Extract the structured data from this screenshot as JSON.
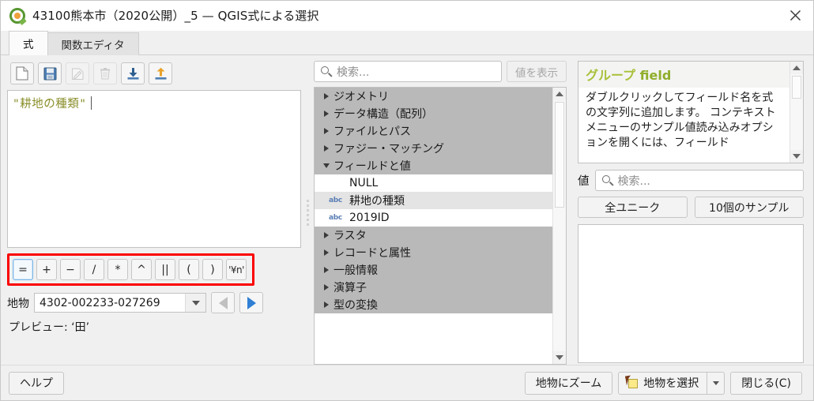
{
  "window": {
    "title": "43100熊本市（2020公開）_5 — QGIS式による選択",
    "logo_icon": "qgis-logo-icon",
    "close_icon": "close-icon"
  },
  "tabs": [
    {
      "label": "式",
      "active": true
    },
    {
      "label": "関数エディタ",
      "active": false
    }
  ],
  "expression_toolbar": [
    {
      "name": "new-expression-button",
      "icon": "new-file-icon",
      "enabled": true
    },
    {
      "name": "save-expression-button",
      "icon": "save-floppy-icon",
      "enabled": true
    },
    {
      "name": "edit-expression-button",
      "icon": "edit-pencil-icon",
      "enabled": false
    },
    {
      "name": "delete-expression-button",
      "icon": "trash-icon",
      "enabled": false
    },
    {
      "name": "import-expressions-button",
      "icon": "import-down-arrow-icon",
      "enabled": true
    },
    {
      "name": "export-expressions-button",
      "icon": "export-up-arrow-icon",
      "enabled": true
    }
  ],
  "editor": {
    "expression": "\"耕地の種類\"",
    "field_color": "#8a8f2a"
  },
  "operators": [
    {
      "label": "=",
      "name": "operator-equals",
      "focused": true
    },
    {
      "label": "+",
      "name": "operator-plus",
      "focused": false
    },
    {
      "label": "−",
      "name": "operator-minus",
      "focused": false
    },
    {
      "label": "/",
      "name": "operator-divide",
      "focused": false
    },
    {
      "label": "*",
      "name": "operator-multiply",
      "focused": false
    },
    {
      "label": "^",
      "name": "operator-power",
      "focused": false
    },
    {
      "label": "||",
      "name": "operator-concat",
      "focused": false
    },
    {
      "label": "(",
      "name": "operator-open-paren",
      "focused": false
    },
    {
      "label": ")",
      "name": "operator-close-paren",
      "focused": false
    },
    {
      "label": "'¥n'",
      "name": "operator-newline",
      "focused": false
    }
  ],
  "annotation": {
    "color": "#fb0000"
  },
  "feature": {
    "label": "地物",
    "value": "4302-002233-027269",
    "prev_enabled": false,
    "next_enabled": true
  },
  "preview": {
    "text": "プレビュー: ‘田’"
  },
  "middle": {
    "search_placeholder": "検索...",
    "show_values_label": "値を表示",
    "show_values_enabled": false,
    "tree": [
      {
        "label": "ジオメトリ",
        "type": "category",
        "expanded": false
      },
      {
        "label": "データ構造（配列）",
        "type": "category",
        "expanded": false
      },
      {
        "label": "ファイルとパス",
        "type": "category",
        "expanded": false
      },
      {
        "label": "ファジー・マッチング",
        "type": "category",
        "expanded": false
      },
      {
        "label": "フィールドと値",
        "type": "category",
        "expanded": true
      },
      {
        "label": "NULL",
        "type": "leaf",
        "badge": "",
        "selected": false
      },
      {
        "label": "耕地の種類",
        "type": "leaf",
        "badge": "abc",
        "selected": true
      },
      {
        "label": "2019ID",
        "type": "leaf",
        "badge": "abc",
        "selected": false
      },
      {
        "label": "ラスタ",
        "type": "category",
        "expanded": false
      },
      {
        "label": "レコードと属性",
        "type": "category",
        "expanded": false
      },
      {
        "label": "一般情報",
        "type": "category",
        "expanded": false
      },
      {
        "label": "演算子",
        "type": "category",
        "expanded": false
      },
      {
        "label": "型の変換",
        "type": "category",
        "expanded": false
      }
    ]
  },
  "help": {
    "title_group": "グループ",
    "title_name": "field",
    "body": "ダブルクリックしてフィールド名を式の文字列に追加します。 コンテキストメニューのサンプル値読み込みオプションを開くには、フィールド",
    "title_color": "#8fae2b"
  },
  "values": {
    "label": "値",
    "search_placeholder": "検索...",
    "all_unique_label": "全ユニーク",
    "sample_label": "10個のサンプル",
    "list": []
  },
  "footer": {
    "help_label": "ヘルプ",
    "zoom_to_features_label": "地物にズーム",
    "select_features_label": "地物を選択",
    "select_features_icon": "select-features-icon",
    "close_label": "閉じる(C)"
  }
}
